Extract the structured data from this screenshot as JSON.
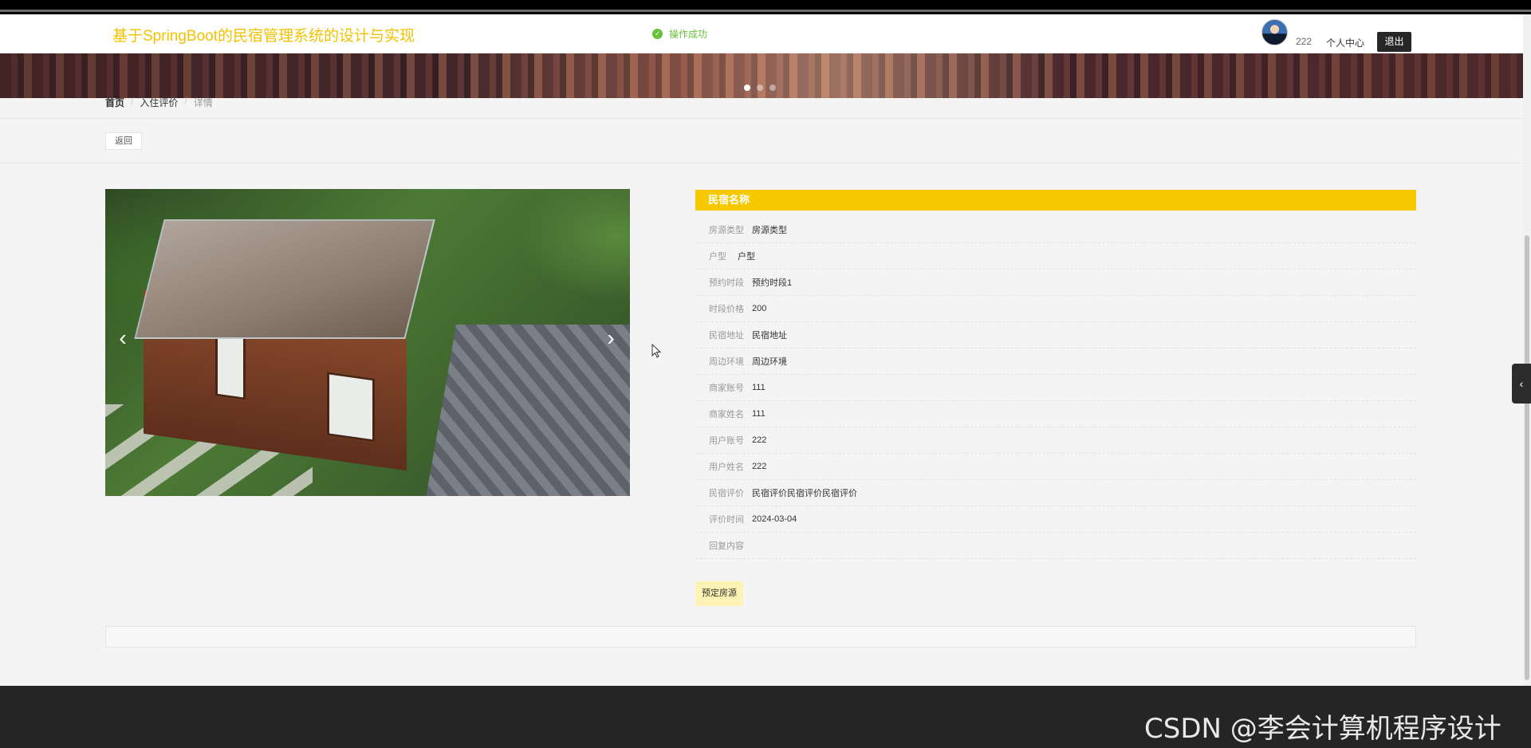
{
  "header": {
    "site_title": "基于SpringBoot的民宿管理系统的设计与实现",
    "toast": "操作成功",
    "user_name": "222",
    "user_center": "个人中心",
    "logout": "退出"
  },
  "breadcrumb": {
    "home": "首页",
    "section": "入住评价",
    "current": "详情"
  },
  "actions": {
    "back": "返回",
    "book": "预定房源"
  },
  "detail": {
    "title": "民宿名称",
    "rows": [
      {
        "key": "房源类型",
        "value": "房源类型"
      },
      {
        "key": "户型",
        "value": "户型"
      },
      {
        "key": "预约时段",
        "value": "预约时段1"
      },
      {
        "key": "时段价格",
        "value": "200"
      },
      {
        "key": "民宿地址",
        "value": "民宿地址"
      },
      {
        "key": "周边环境",
        "value": "周边环境"
      },
      {
        "key": "商家账号",
        "value": "111"
      },
      {
        "key": "商家姓名",
        "value": "111"
      },
      {
        "key": "用户账号",
        "value": "222"
      },
      {
        "key": "用户姓名",
        "value": "222"
      },
      {
        "key": "民宿评价",
        "value": "民宿评价民宿评价民宿评价"
      },
      {
        "key": "评价时间",
        "value": "2024-03-04"
      },
      {
        "key": "回复内容",
        "value": ""
      }
    ]
  },
  "banner": {
    "slide_count": 3,
    "active_index": 0
  },
  "watermark": "CSDN @李会计算机程序设计",
  "colors": {
    "accent": "#f5c800",
    "title": "#f2c200",
    "success": "#67c23a",
    "footer": "#252525"
  }
}
